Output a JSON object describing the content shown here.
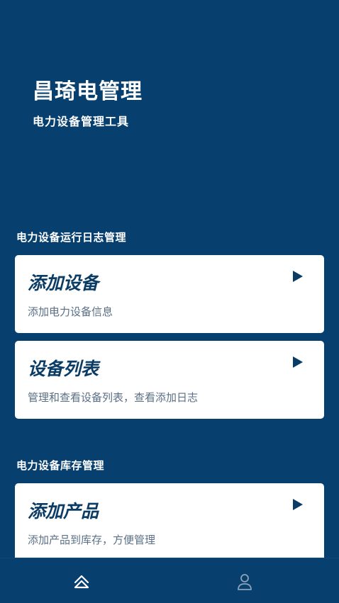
{
  "header": {
    "title": "昌琦电管理",
    "subtitle": "电力设备管理工具"
  },
  "sections": [
    {
      "title": "电力设备运行日志管理",
      "cards": [
        {
          "title": "添加设备",
          "desc": "添加电力设备信息"
        },
        {
          "title": "设备列表",
          "desc": "管理和查看设备列表，查看添加日志"
        }
      ]
    },
    {
      "title": "电力设备库存管理",
      "cards": [
        {
          "title": "添加产品",
          "desc": "添加产品到库存，方便管理"
        }
      ]
    }
  ],
  "tabbar": {
    "tabs": [
      {
        "icon": "home-icon",
        "active": true
      },
      {
        "icon": "user-icon",
        "active": false
      }
    ]
  },
  "colors": {
    "background": "#073f6e",
    "card": "#ffffff",
    "accent": "#0b3c66",
    "muted_text": "#5a6f86"
  }
}
